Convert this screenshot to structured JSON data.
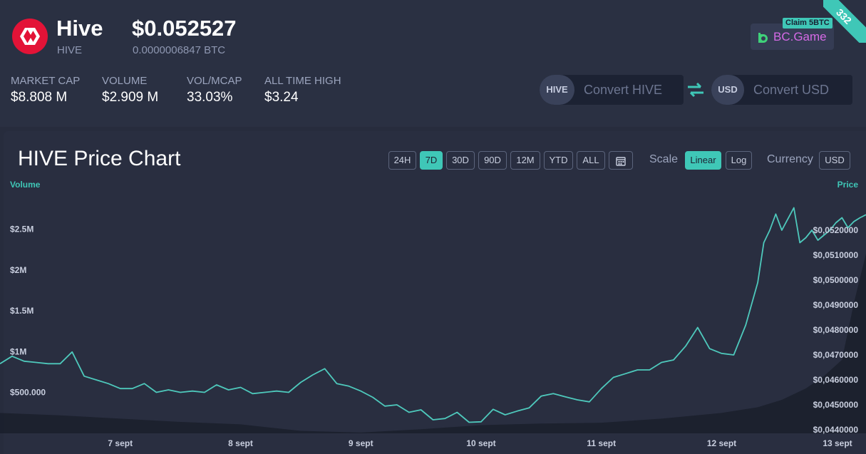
{
  "coin": {
    "name": "Hive",
    "symbol": "HIVE",
    "price_usd": "$0.052527",
    "price_btc": "0.0000006847 BTC"
  },
  "stats": [
    {
      "label": "MARKET CAP",
      "value": "$8.808 M"
    },
    {
      "label": "VOLUME",
      "value": "$2.909 M"
    },
    {
      "label": "VOL/MCAP",
      "value": "33.03%"
    },
    {
      "label": "ALL TIME HIGH",
      "value": "$3.24"
    }
  ],
  "ad": {
    "claim": "Claim 5BTC",
    "brand": "BC.Game",
    "badge": "332"
  },
  "converter": {
    "from_tag": "HIVE",
    "from_placeholder": "Convert HIVE",
    "to_tag": "USD",
    "to_placeholder": "Convert USD",
    "swap_icon": "swap-arrows-icon"
  },
  "chart_section": {
    "title": "HIVE Price Chart",
    "ranges": [
      "24H",
      "7D",
      "30D",
      "90D",
      "12M",
      "YTD",
      "ALL"
    ],
    "active_range": "7D",
    "calendar_icon": "calendar-icon",
    "scale_label": "Scale",
    "scale_options": [
      "Linear",
      "Log"
    ],
    "active_scale": "Linear",
    "currency_label": "Currency",
    "currency_value": "USD"
  },
  "colors": {
    "accent": "#3fc7b7",
    "price_line": "#4ec9bc",
    "volume_area": "#1a1e2c",
    "background": "#272c3d",
    "ad_text": "#d56ae6",
    "hive_red": "#e31337"
  },
  "chart_data": {
    "type": "line",
    "volume_axis_label": "Volume",
    "price_axis_label": "Price",
    "x_ticks": [
      "7 sept",
      "8 sept",
      "9 sept",
      "10 sept",
      "11 sept",
      "12 sept",
      "13 sept"
    ],
    "volume_ticks": [
      "$2.5M",
      "$2M",
      "$1.5M",
      "$1M",
      "$500.000"
    ],
    "price_ticks": [
      "$0,0520000",
      "$0,0510000",
      "$0,0500000",
      "$0,0490000",
      "$0,0480000",
      "$0,0470000",
      "$0,0460000",
      "$0,0450000",
      "$0,0440000"
    ],
    "price_ylim": [
      0.044,
      0.0522
    ],
    "volume_ylim": [
      0,
      2600000
    ],
    "series": [
      {
        "name": "Price",
        "x": [
          6.0,
          6.1,
          6.2,
          6.3,
          6.4,
          6.5,
          6.6,
          6.7,
          6.8,
          6.9,
          7.0,
          7.1,
          7.2,
          7.3,
          7.4,
          7.5,
          7.6,
          7.7,
          7.8,
          7.9,
          8.0,
          8.1,
          8.2,
          8.3,
          8.4,
          8.5,
          8.6,
          8.7,
          8.8,
          8.9,
          9.0,
          9.1,
          9.2,
          9.3,
          9.4,
          9.5,
          9.6,
          9.7,
          9.8,
          9.9,
          10.0,
          10.1,
          10.2,
          10.3,
          10.4,
          10.5,
          10.6,
          10.7,
          10.8,
          10.9,
          11.0,
          11.1,
          11.2,
          11.3,
          11.4,
          11.5,
          11.6,
          11.7,
          11.8,
          11.9,
          12.0,
          12.1,
          12.2,
          12.3,
          12.35,
          12.4,
          12.45,
          12.5,
          12.55,
          12.6,
          12.65,
          12.7,
          12.75,
          12.8,
          12.85,
          12.9,
          12.95,
          13.0,
          13.05,
          13.1,
          13.15,
          13.2
        ],
        "values": [
          0.04665,
          0.04695,
          0.04675,
          0.0467,
          0.04665,
          0.04665,
          0.04712,
          0.04615,
          0.046,
          0.04585,
          0.04565,
          0.04565,
          0.04585,
          0.0455,
          0.0456,
          0.0455,
          0.04555,
          0.0455,
          0.0458,
          0.0456,
          0.0457,
          0.04545,
          0.0455,
          0.04555,
          0.0455,
          0.0459,
          0.0462,
          0.04645,
          0.04585,
          0.04575,
          0.04555,
          0.0453,
          0.04495,
          0.045,
          0.0447,
          0.0448,
          0.0444,
          0.04445,
          0.0447,
          0.0443,
          0.04432,
          0.04482,
          0.0446,
          0.04475,
          0.04488,
          0.04535,
          0.04545,
          0.04532,
          0.0452,
          0.04512,
          0.04565,
          0.0461,
          0.04625,
          0.0464,
          0.0464,
          0.0467,
          0.0468,
          0.04735,
          0.0481,
          0.04725,
          0.04706,
          0.047,
          0.0482,
          0.0499,
          0.0515,
          0.052,
          0.05265,
          0.052,
          0.05245,
          0.0529,
          0.0515,
          0.0517,
          0.052,
          0.0516,
          0.0518,
          0.052,
          0.0523,
          0.0525,
          0.0521,
          0.05235,
          0.0525,
          0.05262
        ]
      },
      {
        "name": "Volume",
        "x": [
          6.0,
          6.5,
          7.0,
          7.5,
          8.0,
          8.5,
          9.0,
          9.5,
          10.0,
          10.5,
          11.0,
          11.5,
          12.0,
          12.3,
          12.5,
          12.7,
          12.85,
          13.0,
          13.1,
          13.2
        ],
        "values": [
          250000,
          220000,
          180000,
          140000,
          110000,
          30000,
          10000,
          50000,
          100000,
          120000,
          130000,
          180000,
          250000,
          320000,
          410000,
          550000,
          700000,
          900000,
          1600000,
          2200000
        ]
      }
    ]
  }
}
